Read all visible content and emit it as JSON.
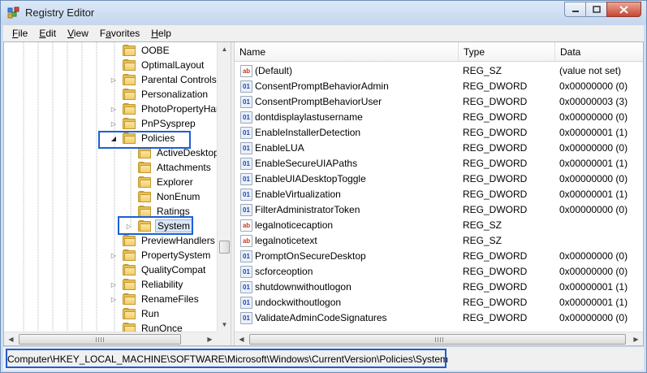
{
  "window": {
    "title": "Registry Editor",
    "minimize": "minimize",
    "maximize": "maximize",
    "close": "close"
  },
  "menu": [
    {
      "accel": "F",
      "rest": "ile"
    },
    {
      "accel": "E",
      "rest": "dit"
    },
    {
      "accel": "V",
      "rest": "iew"
    },
    {
      "accel": "",
      "pre": "F",
      "accel2": "a",
      "rest": "vorites"
    },
    {
      "accel": "H",
      "rest": "elp"
    }
  ],
  "tree": {
    "items": [
      {
        "label": "OOBE",
        "expander": "",
        "level": 0
      },
      {
        "label": "OptimalLayout",
        "expander": "",
        "level": 0
      },
      {
        "label": "Parental Controls",
        "expander": "collapsed",
        "level": 0
      },
      {
        "label": "Personalization",
        "expander": "",
        "level": 0
      },
      {
        "label": "PhotoPropertyHar",
        "expander": "collapsed",
        "level": 0
      },
      {
        "label": "PnPSysprep",
        "expander": "collapsed",
        "level": 0
      },
      {
        "label": "Policies",
        "expander": "expanded",
        "level": 0
      },
      {
        "label": "ActiveDesktop",
        "expander": "",
        "level": 1
      },
      {
        "label": "Attachments",
        "expander": "",
        "level": 1
      },
      {
        "label": "Explorer",
        "expander": "",
        "level": 1
      },
      {
        "label": "NonEnum",
        "expander": "",
        "level": 1
      },
      {
        "label": "Ratings",
        "expander": "",
        "level": 1
      },
      {
        "label": "System",
        "expander": "collapsed",
        "level": 1,
        "selected": true
      },
      {
        "label": "PreviewHandlers",
        "expander": "",
        "level": 0
      },
      {
        "label": "PropertySystem",
        "expander": "collapsed",
        "level": 0
      },
      {
        "label": "QualityCompat",
        "expander": "",
        "level": 0
      },
      {
        "label": "Reliability",
        "expander": "collapsed",
        "level": 0
      },
      {
        "label": "RenameFiles",
        "expander": "collapsed",
        "level": 0
      },
      {
        "label": "Run",
        "expander": "",
        "level": 0
      },
      {
        "label": "RunOnce",
        "expander": "",
        "level": 0
      }
    ]
  },
  "list": {
    "columns": {
      "name": "Name",
      "type": "Type",
      "data": "Data"
    },
    "rows": [
      {
        "kind": "sz",
        "name": "(Default)",
        "type": "REG_SZ",
        "data": "(value not set)"
      },
      {
        "kind": "dword",
        "name": "ConsentPromptBehaviorAdmin",
        "type": "REG_DWORD",
        "data": "0x00000000 (0)"
      },
      {
        "kind": "dword",
        "name": "ConsentPromptBehaviorUser",
        "type": "REG_DWORD",
        "data": "0x00000003 (3)"
      },
      {
        "kind": "dword",
        "name": "dontdisplaylastusername",
        "type": "REG_DWORD",
        "data": "0x00000000 (0)"
      },
      {
        "kind": "dword",
        "name": "EnableInstallerDetection",
        "type": "REG_DWORD",
        "data": "0x00000001 (1)"
      },
      {
        "kind": "dword",
        "name": "EnableLUA",
        "type": "REG_DWORD",
        "data": "0x00000000 (0)"
      },
      {
        "kind": "dword",
        "name": "EnableSecureUIAPaths",
        "type": "REG_DWORD",
        "data": "0x00000001 (1)"
      },
      {
        "kind": "dword",
        "name": "EnableUIADesktopToggle",
        "type": "REG_DWORD",
        "data": "0x00000000 (0)"
      },
      {
        "kind": "dword",
        "name": "EnableVirtualization",
        "type": "REG_DWORD",
        "data": "0x00000001 (1)"
      },
      {
        "kind": "dword",
        "name": "FilterAdministratorToken",
        "type": "REG_DWORD",
        "data": "0x00000000 (0)"
      },
      {
        "kind": "sz",
        "name": "legalnoticecaption",
        "type": "REG_SZ",
        "data": ""
      },
      {
        "kind": "sz",
        "name": "legalnoticetext",
        "type": "REG_SZ",
        "data": ""
      },
      {
        "kind": "dword",
        "name": "PromptOnSecureDesktop",
        "type": "REG_DWORD",
        "data": "0x00000000 (0)"
      },
      {
        "kind": "dword",
        "name": "scforceoption",
        "type": "REG_DWORD",
        "data": "0x00000000 (0)"
      },
      {
        "kind": "dword",
        "name": "shutdownwithoutlogon",
        "type": "REG_DWORD",
        "data": "0x00000001 (1)"
      },
      {
        "kind": "dword",
        "name": "undockwithoutlogon",
        "type": "REG_DWORD",
        "data": "0x00000001 (1)"
      },
      {
        "kind": "dword",
        "name": "ValidateAdminCodeSignatures",
        "type": "REG_DWORD",
        "data": "0x00000000 (0)"
      }
    ]
  },
  "icons": {
    "sz": "ab",
    "dword": "01"
  },
  "status": {
    "path": "Computer\\HKEY_LOCAL_MACHINE\\SOFTWARE\\Microsoft\\Windows\\CurrentVersion\\Policies\\System"
  },
  "colors": {
    "highlight": "#1b5fd6",
    "selection": "#dbe7f7"
  }
}
